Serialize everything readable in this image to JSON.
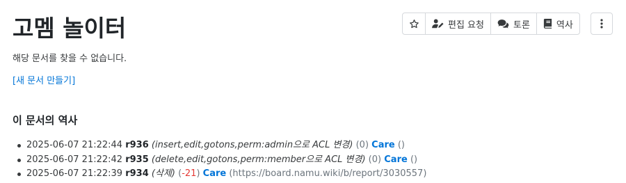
{
  "page": {
    "title": "고멤 놀이터",
    "notice": "해당 문서를 찾을 수 없습니다.",
    "create_link": "[새 문서 만들기]",
    "history_heading": "이 문서의 역사"
  },
  "toolbar": {
    "star_icon": "star-outline",
    "edit_request_label": "편집 요청",
    "edit_request_icon": "user-pen",
    "discuss_label": "토론",
    "discuss_icon": "comments",
    "history_label": "역사",
    "history_icon": "book",
    "more_icon": "vertical-ellipsis"
  },
  "history": [
    {
      "timestamp": "2025-06-07 21:22:44",
      "revision": "r936",
      "summary": "(insert,edit,gotons,perm:admin으로 ACL 변경)",
      "diff_open": "(",
      "diff": "0",
      "diff_close": ")",
      "user": "Care",
      "reason": "()"
    },
    {
      "timestamp": "2025-06-07 21:22:42",
      "revision": "r935",
      "summary": "(delete,edit,gotons,perm:member으로 ACL 변경)",
      "diff_open": "(",
      "diff": "0",
      "diff_close": ")",
      "user": "Care",
      "reason": "()"
    },
    {
      "timestamp": "2025-06-07 21:22:39",
      "revision": "r934",
      "summary": "(삭제)",
      "diff_open": "(",
      "diff": "-21",
      "diff_close": ")",
      "user": "Care",
      "reason": "(https://board.namu.wiki/b/report/3030557)"
    }
  ],
  "colors": {
    "link": "#0275d8",
    "negative_diff": "#e53935",
    "border": "#d5d8dc"
  }
}
